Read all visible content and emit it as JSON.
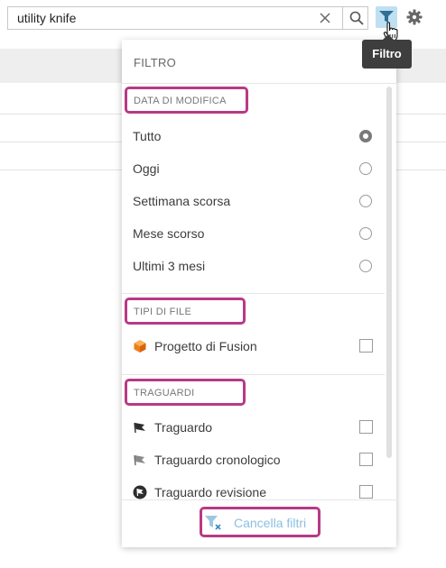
{
  "search": {
    "value": "utility knife"
  },
  "tooltip": {
    "text": "Filtro"
  },
  "panel": {
    "title": "FILTRO",
    "sections": [
      {
        "header": "DATA DI MODIFICA",
        "options": [
          "Tutto",
          "Oggi",
          "Settimana scorsa",
          "Mese scorso",
          "Ultimi 3 mesi"
        ],
        "selected": "Tutto"
      },
      {
        "header": "TIPI DI FILE",
        "options": [
          "Progetto di Fusion"
        ]
      },
      {
        "header": "TRAGUARDI",
        "options": [
          "Traguardo",
          "Traguardo cronologico",
          "Traguardo revisione"
        ]
      }
    ],
    "clear_label": "Cancella filtri"
  },
  "colors": {
    "highlight": "#b83a84",
    "filter_active": "#bfe0f2",
    "clear_link": "#8bbfe0"
  },
  "icons": [
    "close-icon",
    "search-icon",
    "funnel-icon",
    "hand-cursor-icon",
    "gear-icon",
    "fusion-cube-icon",
    "flag-icon",
    "flag-timeline-icon",
    "flag-revision-icon",
    "clear-filter-icon"
  ]
}
